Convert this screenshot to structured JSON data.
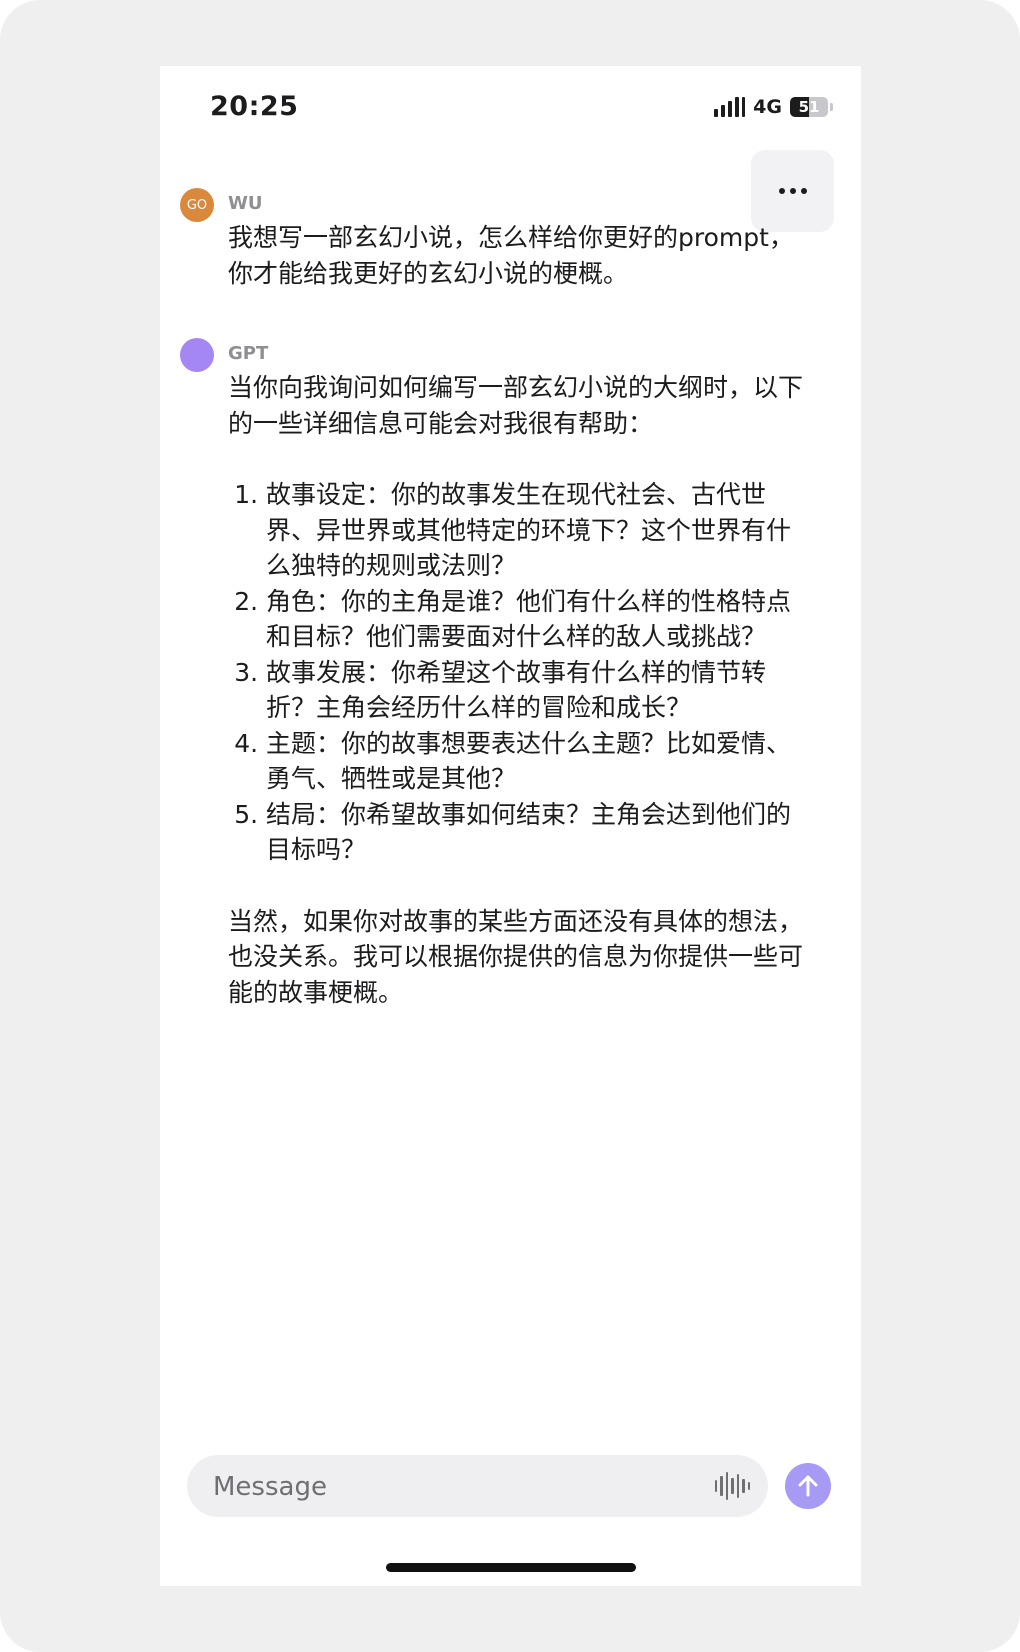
{
  "status_bar": {
    "time": "20:25",
    "network": "4G",
    "battery": "51",
    "battery_level": 51
  },
  "conversation": {
    "user": {
      "avatar_text": "GO",
      "name": "WU",
      "message": "我想写一部玄幻小说，怎么样给你更好的prompt，你才能给我更好的玄幻小说的梗概。"
    },
    "assistant": {
      "name": "GPT",
      "intro": "当你向我询问如何编写一部玄幻小说的大纲时，以下的一些详细信息可能会对我很有帮助：",
      "items": [
        "故事设定：你的故事发生在现代社会、古代世界、异世界或其他特定的环境下？这个世界有什么独特的规则或法则？",
        "角色：你的主角是谁？他们有什么样的性格特点和目标？他们需要面对什么样的敌人或挑战？",
        "故事发展：你希望这个故事有什么样的情节转折？主角会经历什么样的冒险和成长？",
        "主题：你的故事想要表达什么主题？比如爱情、勇气、牺牲或是其他？",
        "结局：你希望故事如何结束？主角会达到他们的目标吗？"
      ],
      "closing": "当然，如果你对故事的某些方面还没有具体的想法，也没关系。我可以根据你提供的信息为你提供一些可能的故事梗概。"
    }
  },
  "composer": {
    "placeholder": "Message"
  },
  "colors": {
    "user_avatar": "#d9883c",
    "assistant_avatar": "#a487f2",
    "send_button": "#a79af4"
  },
  "icons": {
    "more": "more-horizontal-icon",
    "voice": "waveform-icon",
    "send": "arrow-up-icon"
  }
}
